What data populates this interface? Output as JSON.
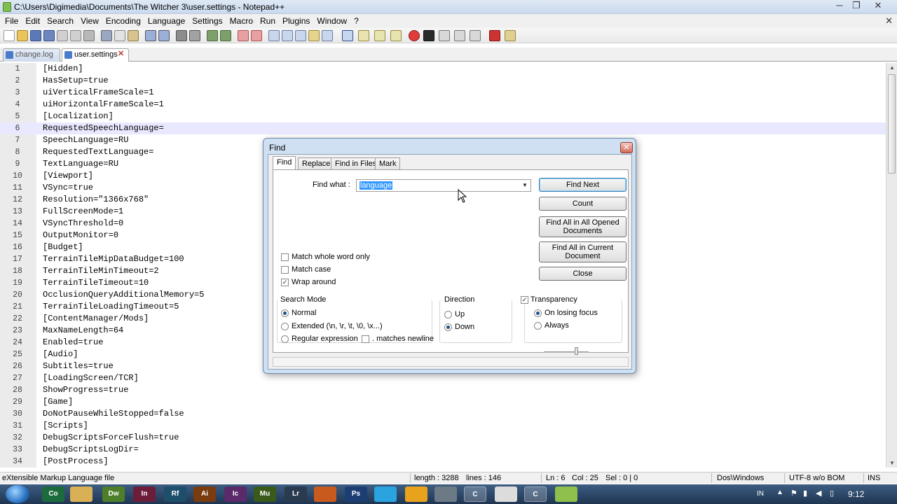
{
  "window": {
    "title": "C:\\Users\\Digimedia\\Documents\\The Witcher 3\\user.settings - Notepad++",
    "minimize": "─",
    "restore": "❐",
    "close": "✕"
  },
  "menu": [
    "File",
    "Edit",
    "Search",
    "View",
    "Encoding",
    "Language",
    "Settings",
    "Macro",
    "Run",
    "Plugins",
    "Window",
    "?"
  ],
  "menu_close": "✕",
  "tabs": [
    {
      "label": "change.log"
    },
    {
      "label": "user.settings",
      "close": "✕"
    }
  ],
  "editor": {
    "current_line": 6,
    "lines": [
      {
        "n": "1",
        "text": "[Hidden]"
      },
      {
        "n": "2",
        "text": "HasSetup=true"
      },
      {
        "n": "3",
        "text": "uiVerticalFrameScale=1"
      },
      {
        "n": "4",
        "text": "uiHorizontalFrameScale=1"
      },
      {
        "n": "5",
        "text": "[Localization]"
      },
      {
        "n": "6",
        "text": "RequestedSpeechLanguage="
      },
      {
        "n": "7",
        "text": "SpeechLanguage=RU"
      },
      {
        "n": "8",
        "text": "RequestedTextLanguage="
      },
      {
        "n": "9",
        "text": "TextLanguage=RU"
      },
      {
        "n": "10",
        "text": "[Viewport]"
      },
      {
        "n": "11",
        "text": "VSync=true"
      },
      {
        "n": "12",
        "text": "Resolution=\"1366x768\""
      },
      {
        "n": "13",
        "text": "FullScreenMode=1"
      },
      {
        "n": "14",
        "text": "VSyncThreshold=0"
      },
      {
        "n": "15",
        "text": "OutputMonitor=0"
      },
      {
        "n": "16",
        "text": "[Budget]"
      },
      {
        "n": "17",
        "text": "TerrainTileMipDataBudget=100"
      },
      {
        "n": "18",
        "text": "TerrainTileMinTimeout=2"
      },
      {
        "n": "19",
        "text": "TerrainTileTimeout=10"
      },
      {
        "n": "20",
        "text": "OcclusionQueryAdditionalMemory=5"
      },
      {
        "n": "21",
        "text": "TerrainTileLoadingTimeout=5"
      },
      {
        "n": "22",
        "text": "[ContentManager/Mods]"
      },
      {
        "n": "23",
        "text": "MaxNameLength=64"
      },
      {
        "n": "24",
        "text": "Enabled=true"
      },
      {
        "n": "25",
        "text": "[Audio]"
      },
      {
        "n": "26",
        "text": "Subtitles=true"
      },
      {
        "n": "27",
        "text": "[LoadingScreen/TCR]"
      },
      {
        "n": "28",
        "text": "ShowProgress=true"
      },
      {
        "n": "29",
        "text": "[Game]"
      },
      {
        "n": "30",
        "text": "DoNotPauseWhileStopped=false"
      },
      {
        "n": "31",
        "text": "[Scripts]"
      },
      {
        "n": "32",
        "text": "DebugScriptsForceFlush=true"
      },
      {
        "n": "33",
        "text": "DebugScriptsLogDir="
      },
      {
        "n": "34",
        "text": "[PostProcess]"
      }
    ]
  },
  "status": {
    "filetype": "eXtensible Markup Language file",
    "length": "length : 3288",
    "lines": "lines : 146",
    "ln": "Ln : 6",
    "col": "Col : 25",
    "sel": "Sel : 0 | 0",
    "eol": "Dos\\Windows",
    "encoding": "UTF-8 w/o BOM",
    "mode": "INS"
  },
  "taskbar": {
    "apps": [
      "Co",
      "",
      "Dw",
      "In",
      "Rf",
      "Ai",
      "Ic",
      "Mu",
      "Lr",
      "",
      "Ps",
      "",
      "",
      "",
      "C",
      "",
      "C",
      ""
    ],
    "lang": "IN",
    "clock": "9:12"
  },
  "find_dialog": {
    "title": "Find",
    "close": "✕",
    "tabs": [
      "Find",
      "Replace",
      "Find in Files",
      "Mark"
    ],
    "find_what_label": "Find what :",
    "find_what_value": "language",
    "buttons": {
      "find_next": "Find Next",
      "count": "Count",
      "find_all_opened": "Find All in All Opened Documents",
      "find_all_current": "Find All in Current Document",
      "close": "Close"
    },
    "options": {
      "match_whole_word": {
        "label": "Match whole word only",
        "checked": false
      },
      "match_case": {
        "label": "Match case",
        "checked": false
      },
      "wrap_around": {
        "label": "Wrap around",
        "checked": true
      }
    },
    "search_mode": {
      "label": "Search Mode",
      "normal": "Normal",
      "extended": "Extended (\\n, \\r, \\t, \\0, \\x...)",
      "regex": "Regular expression",
      "matches_newline": ". matches newline",
      "selected": "Normal"
    },
    "direction": {
      "label": "Direction",
      "up": "Up",
      "down": "Down",
      "selected": "Down"
    },
    "transparency": {
      "label": "Transparency",
      "checked": true,
      "on_losing_focus": "On losing focus",
      "always": "Always",
      "selected": "On losing focus"
    }
  }
}
